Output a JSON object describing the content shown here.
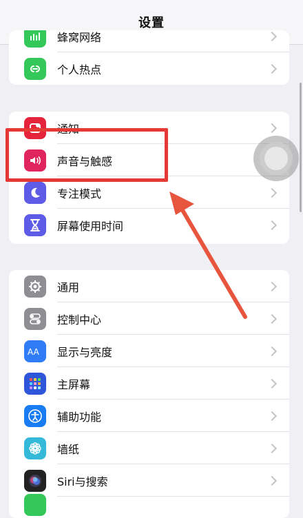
{
  "nav": {
    "title": "设置"
  },
  "group1": {
    "rows": [
      {
        "label": "蜂窝网络",
        "icon": "antenna-icon",
        "color": "#34c759"
      },
      {
        "label": "个人热点",
        "icon": "hotspot-link-icon",
        "color": "#34c759"
      }
    ]
  },
  "group2": {
    "rows": [
      {
        "label": "通知",
        "icon": "notification-icon",
        "color": "#e5243b"
      },
      {
        "label": "声音与触感",
        "icon": "speaker-icon",
        "color": "#e0245e"
      },
      {
        "label": "专注模式",
        "icon": "moon-icon",
        "color": "#5e5ce6"
      },
      {
        "label": "屏幕使用时间",
        "icon": "hourglass-icon",
        "color": "#5e5ce6"
      }
    ]
  },
  "group3": {
    "rows": [
      {
        "label": "通用",
        "icon": "gear-icon",
        "color": "#8e8e93"
      },
      {
        "label": "控制中心",
        "icon": "toggles-icon",
        "color": "#8e8e93"
      },
      {
        "label": "显示与亮度",
        "icon": "text-size-icon",
        "color": "#2f7cf6"
      },
      {
        "label": "主屏幕",
        "icon": "app-grid-icon",
        "color": "#2f56d8"
      },
      {
        "label": "辅助功能",
        "icon": "accessibility-icon",
        "color": "#1a7cf5"
      },
      {
        "label": "墙纸",
        "icon": "flower-icon",
        "color": "#35b9d9"
      },
      {
        "label": "Siri与搜索",
        "icon": "siri-icon",
        "color": "#222222"
      }
    ]
  },
  "annotation": {
    "box_color": "#e53935",
    "arrow_color": "#e8553f"
  }
}
